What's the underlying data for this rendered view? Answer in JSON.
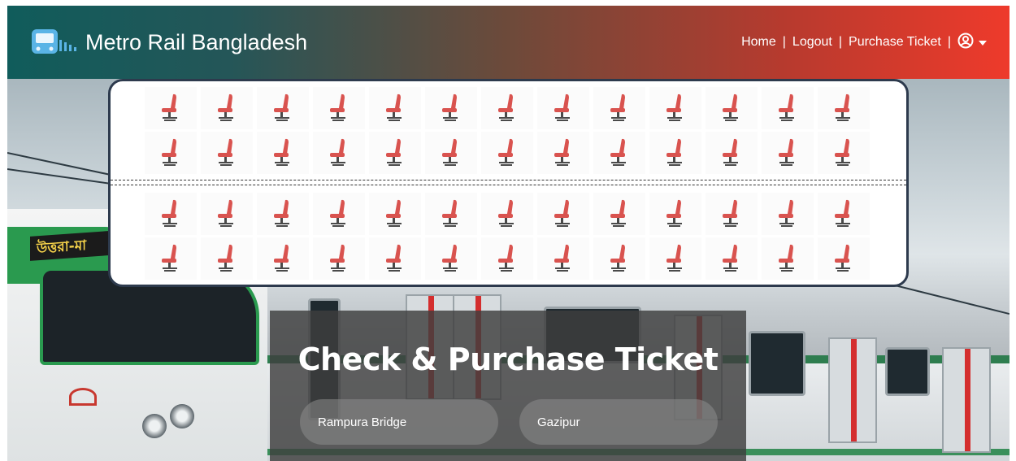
{
  "header": {
    "brand_title": "Metro Rail Bangladesh",
    "brand_icon": "metro-train-icon",
    "nav": {
      "home": "Home",
      "logout": "Logout",
      "purchase": "Purchase Ticket",
      "separator": "|",
      "user_icon": "user-circle-icon",
      "caret_icon": "caret-down-icon"
    }
  },
  "hero": {
    "train_sign": "উত্তরা-মা"
  },
  "seatmap": {
    "seat_icon": "seat-icon",
    "seat_color": "#d9534f",
    "seats_per_row": 13,
    "rows_above_aisle": 2,
    "rows_below_aisle": 2
  },
  "ticket": {
    "title": "Check & Purchase Ticket",
    "from_value": "Rampura Bridge",
    "to_value": "Gazipur"
  },
  "colors": {
    "header_start": "#105c5b",
    "header_end": "#ee3a2b",
    "seat_red": "#d9534f",
    "panel_bg": "#3e3e3e"
  }
}
